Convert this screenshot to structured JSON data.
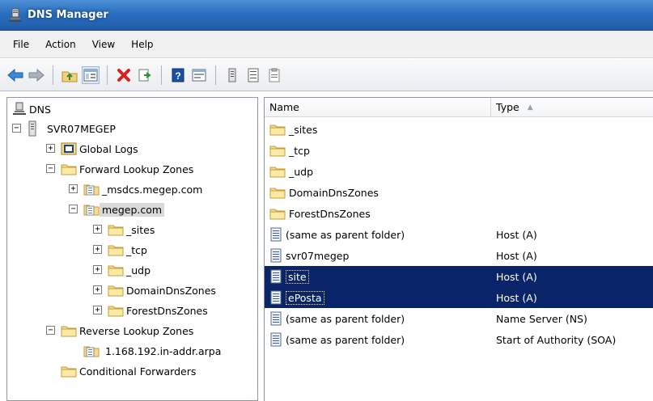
{
  "window": {
    "title": "DNS Manager"
  },
  "menu": [
    "File",
    "Action",
    "View",
    "Help"
  ],
  "toolbar": {
    "icons": [
      "back-arrow-icon",
      "forward-arrow-icon",
      "up-folder-icon",
      "show-hide-tree-icon",
      "delete-icon",
      "export-list-icon",
      "help-icon",
      "properties-icon",
      "server-icon",
      "list-icon",
      "notes-icon"
    ]
  },
  "tree": {
    "root": "DNS",
    "server": "SVR07MEGEP",
    "global_logs": "Global Logs",
    "forward_zones": "Forward Lookup Zones",
    "msdcs_zone": "_msdcs.megep.com",
    "megep_zone": "megep.com",
    "sites": "_sites",
    "tcp": "_tcp",
    "udp": "_udp",
    "domain_dns_zones": "DomainDnsZones",
    "forest_dns_zones": "ForestDnsZones",
    "reverse_zones": "Reverse Lookup Zones",
    "reverse_zone_1": "1.168.192.in-addr.arpa",
    "conditional_forwarders": "Conditional Forwarders"
  },
  "list": {
    "columns": {
      "name": "Name",
      "type": "Type"
    },
    "rows": [
      {
        "name": "_sites",
        "type": "",
        "icon": "folder"
      },
      {
        "name": "_tcp",
        "type": "",
        "icon": "folder"
      },
      {
        "name": "_udp",
        "type": "",
        "icon": "folder"
      },
      {
        "name": "DomainDnsZones",
        "type": "",
        "icon": "folder"
      },
      {
        "name": "ForestDnsZones",
        "type": "",
        "icon": "folder"
      },
      {
        "name": "(same as parent folder)",
        "type": "Host (A)",
        "icon": "record"
      },
      {
        "name": "svr07megep",
        "type": "Host (A)",
        "icon": "record"
      },
      {
        "name": "site",
        "type": "Host (A)",
        "icon": "record",
        "selected": true
      },
      {
        "name": "ePosta",
        "type": "Host (A)",
        "icon": "record",
        "selected": true
      },
      {
        "name": "(same as parent folder)",
        "type": "Name Server (NS)",
        "icon": "record"
      },
      {
        "name": "(same as parent folder)",
        "type": "Start of Authority (SOA)",
        "icon": "record"
      }
    ]
  },
  "colors": {
    "selection": "#0a246a",
    "titlebar": "#2a6fbf"
  }
}
